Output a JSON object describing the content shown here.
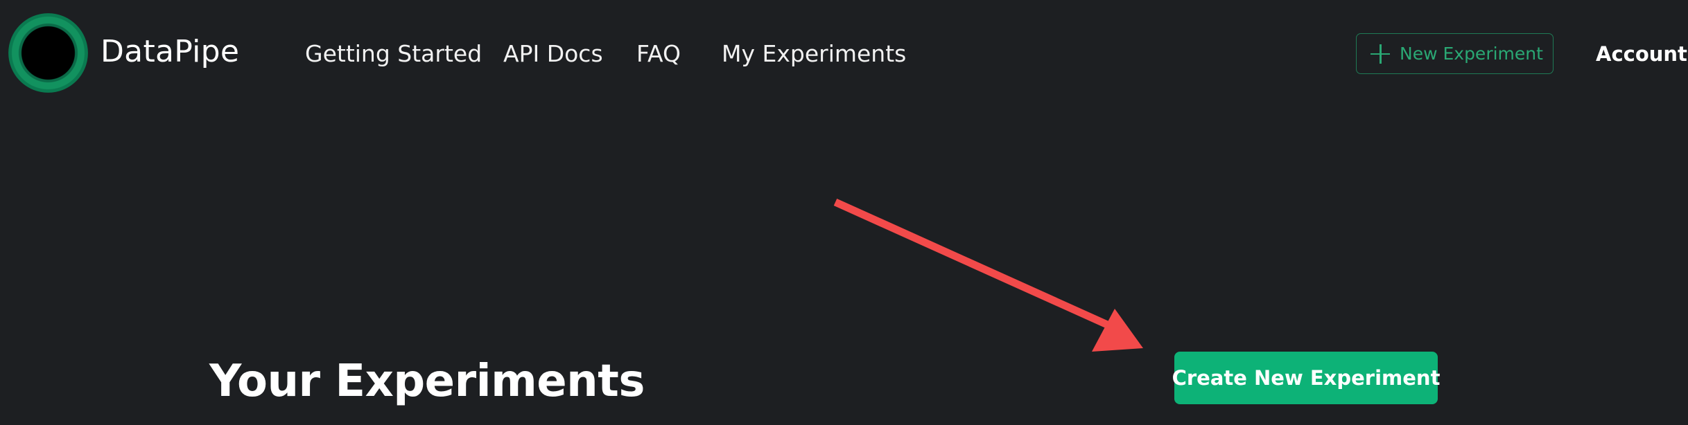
{
  "header": {
    "brand": "DataPipe",
    "logo_icon": "datapipe-logo-icon",
    "nav": [
      {
        "label": "Getting Started"
      },
      {
        "label": "API Docs"
      },
      {
        "label": "FAQ"
      },
      {
        "label": "My Experiments"
      }
    ],
    "new_experiment_label": "New Experiment",
    "new_experiment_icon": "plus-icon",
    "account_label": "Account"
  },
  "main": {
    "title": "Your Experiments",
    "create_button_label": "Create New Experiment"
  },
  "annotation": {
    "icon": "arrow-icon",
    "color": "#f24a4a"
  },
  "colors": {
    "background": "#1d1f22",
    "accent": "#0db277",
    "outline_accent": "#2aa874"
  }
}
